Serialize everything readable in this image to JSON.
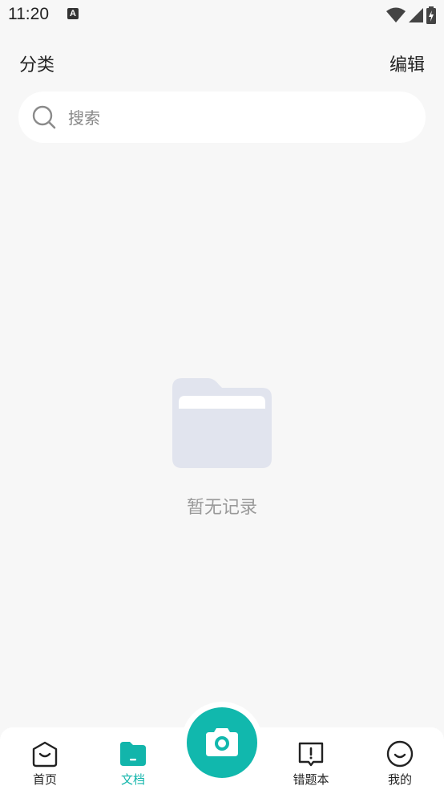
{
  "status_bar": {
    "time": "11:20",
    "notification_letter": "A"
  },
  "header": {
    "title": "分类",
    "edit_label": "编辑"
  },
  "search": {
    "placeholder": "搜索",
    "value": ""
  },
  "empty_state": {
    "text": "暂无记录",
    "icon": "folder-icon"
  },
  "bottom_nav": {
    "items": [
      {
        "label": "首页",
        "icon": "home-face-icon",
        "active": false
      },
      {
        "label": "文档",
        "icon": "document-folder-icon",
        "active": true
      },
      {
        "label": "错题本",
        "icon": "mistake-book-icon",
        "active": false
      },
      {
        "label": "我的",
        "icon": "profile-smile-icon",
        "active": false
      }
    ],
    "camera_icon": "camera-icon"
  },
  "colors": {
    "accent": "#11b8ad",
    "background": "#f7f7f7",
    "empty_icon": "#e1e4ee"
  }
}
